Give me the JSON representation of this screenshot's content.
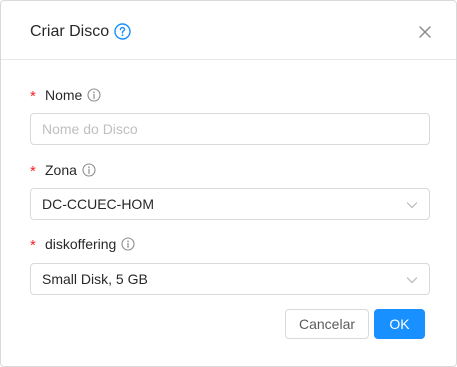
{
  "dialog": {
    "title": "Criar Disco",
    "help_icon": "question-circle-icon",
    "close_icon": "close-icon"
  },
  "form": {
    "name": {
      "label": "Nome",
      "required_mark": "*",
      "info_icon": "info-circle-icon",
      "value": "",
      "placeholder": "Nome do Disco"
    },
    "zone": {
      "label": "Zona",
      "required_mark": "*",
      "info_icon": "info-circle-icon",
      "selected": "DC-CCUEC-HOM",
      "arrow_icon": "chevron-down-icon"
    },
    "diskoffering": {
      "label": "diskoffering",
      "required_mark": "*",
      "info_icon": "info-circle-icon",
      "selected": "Small Disk, 5 GB",
      "arrow_icon": "chevron-down-icon"
    }
  },
  "footer": {
    "cancel_label": "Cancelar",
    "ok_label": "OK"
  },
  "colors": {
    "primary": "#1890ff",
    "required": "#f5222d",
    "border": "#d9d9d9"
  }
}
